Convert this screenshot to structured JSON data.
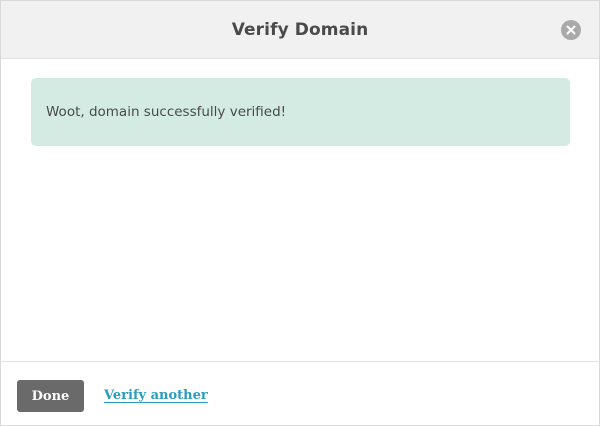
{
  "dialog": {
    "title": "Verify Domain",
    "close_icon": "close-icon"
  },
  "alert": {
    "message": "Woot, domain successfully verified!",
    "background_color": "#d3ebe3"
  },
  "footer": {
    "done_label": "Done",
    "verify_another_label": "Verify another",
    "link_color": "#2a9cbf",
    "button_color": "#6a6a6a"
  }
}
